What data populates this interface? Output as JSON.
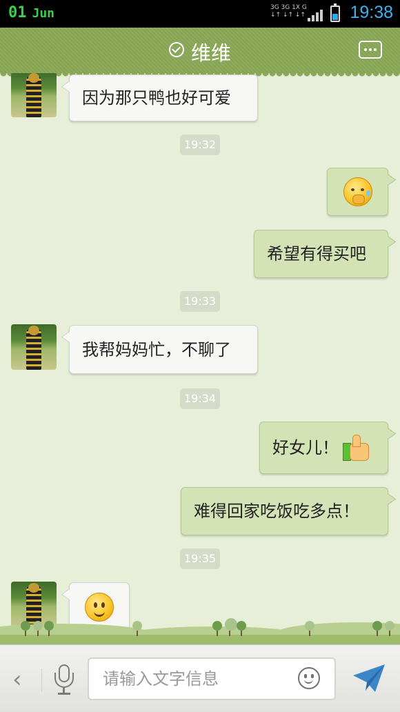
{
  "status_bar": {
    "date_day": "01",
    "date_month": "Jun",
    "network_top": "3G 3G 1X  G",
    "network_bottom": "↓↑ ↓↑ ↓↑",
    "time": "19:38",
    "battery_level": 0.45,
    "colors": {
      "date": "#3ad04a",
      "time": "#39b3f0",
      "battery": "#2aa8e8"
    }
  },
  "header": {
    "title": "维维",
    "verified_icon": "check-circle-icon",
    "more_icon": "more-icon",
    "color": "#8aa857"
  },
  "messages": [
    {
      "side": "left",
      "type": "text",
      "text": "因为那只鸭也好可爱"
    },
    {
      "type": "timestamp",
      "text": "19:32"
    },
    {
      "side": "right",
      "type": "emoji",
      "emoji": "sad-face-emoji"
    },
    {
      "side": "right",
      "type": "text",
      "text": "希望有得买吧"
    },
    {
      "type": "timestamp",
      "text": "19:33"
    },
    {
      "side": "left",
      "type": "text",
      "text": "我帮妈妈忙，不聊了"
    },
    {
      "type": "timestamp",
      "text": "19:34"
    },
    {
      "side": "right",
      "type": "text",
      "text": "好女儿！",
      "emoji": "thumbs-up-emoji"
    },
    {
      "side": "right",
      "type": "text",
      "text": "难得回家吃饭吃多点！"
    },
    {
      "type": "timestamp",
      "text": "19:35"
    },
    {
      "side": "left",
      "type": "emoji",
      "emoji": "smile-face-emoji"
    }
  ],
  "input_bar": {
    "placeholder": "请输入文字信息",
    "back_icon": "chevron-left-icon",
    "voice_icon": "microphone-icon",
    "emoji_icon": "smiley-icon",
    "send_icon": "send-icon",
    "send_color": "#3a86c8"
  }
}
